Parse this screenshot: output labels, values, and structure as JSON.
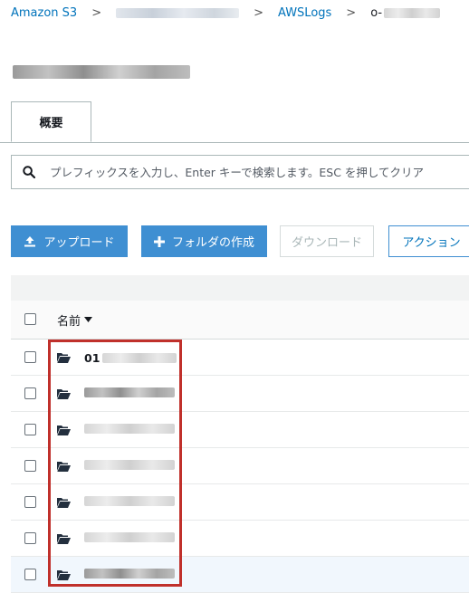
{
  "breadcrumb": {
    "items": [
      "Amazon S3",
      "AWSLogs",
      "o-"
    ],
    "separator": ">"
  },
  "tabs": [
    {
      "label": "概要"
    }
  ],
  "search": {
    "placeholder": "プレフィックスを入力し、Enter キーで検索します。ESC を押してクリア"
  },
  "toolbar": {
    "upload_label": "アップロード",
    "create_folder_label": "フォルダの作成",
    "download_label": "ダウンロード",
    "actions_label": "アクション"
  },
  "table": {
    "name_header": "名前",
    "rows": [
      {
        "name": "01",
        "type": "folder",
        "selected": false
      },
      {
        "name": "",
        "type": "folder",
        "selected": false
      },
      {
        "name": "",
        "type": "folder",
        "selected": false
      },
      {
        "name": "",
        "type": "folder",
        "selected": false
      },
      {
        "name": "",
        "type": "folder",
        "selected": false
      },
      {
        "name": "",
        "type": "folder",
        "selected": false
      },
      {
        "name": "",
        "type": "folder",
        "selected": true
      }
    ]
  },
  "colors": {
    "primary_button": "#3f8fd2",
    "link": "#0073bb",
    "highlight_box": "#c0302b"
  }
}
